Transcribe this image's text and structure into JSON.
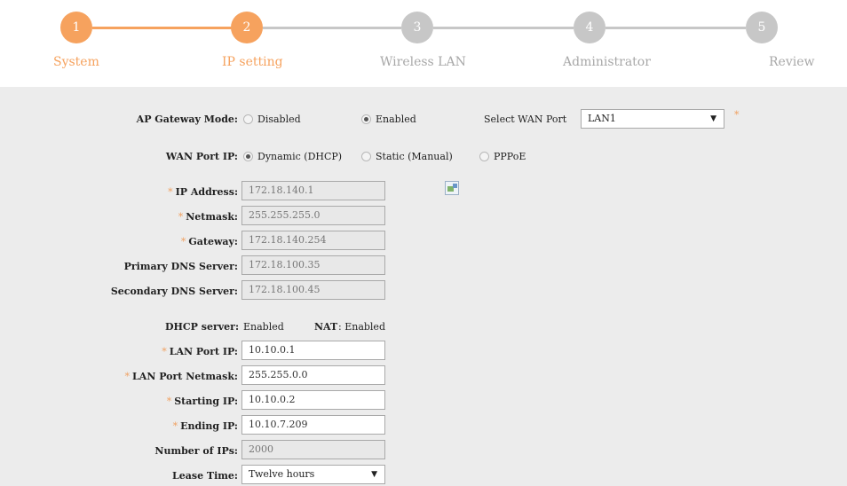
{
  "wizard": {
    "steps": [
      {
        "number": "1",
        "label": "System"
      },
      {
        "number": "2",
        "label": "IP setting"
      },
      {
        "number": "3",
        "label": "Wireless LAN"
      },
      {
        "number": "4",
        "label": "Administrator"
      },
      {
        "number": "5",
        "label": "Review"
      }
    ],
    "colors": {
      "active": "#f6a25e",
      "inactive": "#c7c7c7",
      "active_text": "#f6a25e",
      "inactive_text": "#a8a8a8"
    }
  },
  "gateway": {
    "label": "AP Gateway Mode:",
    "options": [
      {
        "label": "Disabled",
        "selected": false
      },
      {
        "label": "Enabled",
        "selected": true
      }
    ],
    "wan_port_label": "Select WAN Port",
    "wan_port_value": "LAN1",
    "required_mark": "*"
  },
  "wan_port_ip": {
    "label": "WAN Port IP:",
    "options": [
      {
        "label": "Dynamic (DHCP)",
        "selected": true
      },
      {
        "label": "Static (Manual)",
        "selected": false
      },
      {
        "label": "PPPoE",
        "selected": false
      }
    ]
  },
  "wan_fields": [
    {
      "label": "IP Address:",
      "required": true,
      "value": "172.18.140.1"
    },
    {
      "label": "Netmask:",
      "required": true,
      "value": "255.255.255.0"
    },
    {
      "label": "Gateway:",
      "required": true,
      "value": "172.18.140.254"
    },
    {
      "label": "Primary DNS Server:",
      "required": false,
      "value": "172.18.100.35"
    },
    {
      "label": "Secondary DNS Server:",
      "required": false,
      "value": "172.18.100.45"
    }
  ],
  "status": {
    "dhcp_label": "DHCP server:",
    "dhcp_value": "Enabled",
    "nat_label": "NAT",
    "nat_value": ": Enabled"
  },
  "lan_fields": [
    {
      "label": "LAN Port IP:",
      "required": true,
      "value": "10.10.0.1"
    },
    {
      "label": "LAN Port Netmask:",
      "required": true,
      "value": "255.255.0.0"
    },
    {
      "label": "Starting IP:",
      "required": true,
      "value": "10.10.0.2"
    },
    {
      "label": "Ending IP:",
      "required": true,
      "value": "10.10.7.209"
    }
  ],
  "num_ips": {
    "label": "Number of IPs:",
    "value": "2000"
  },
  "lease": {
    "label": "Lease Time:",
    "value": "Twelve hours"
  }
}
